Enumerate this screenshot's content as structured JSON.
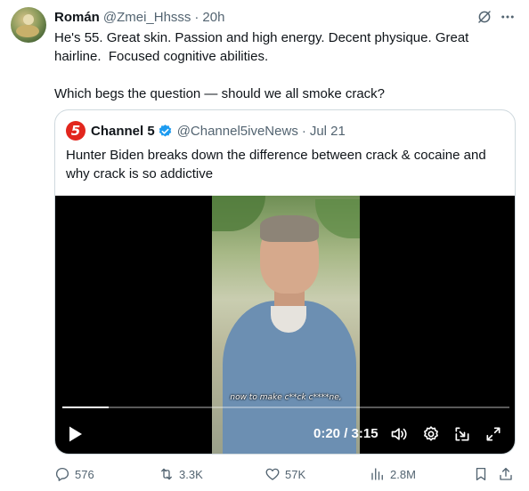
{
  "tweet": {
    "author_name": "Román",
    "author_handle": "@Zmei_Hhsss",
    "separator": "·",
    "time": "20h",
    "text": "He's 55. Great skin. Passion and high energy. Decent physique. Great hairline.  Focused cognitive abilities.\n\nWhich begs the question — should we all smoke crack?"
  },
  "quote": {
    "logo_text": "5",
    "author_name": "Channel 5",
    "author_handle": "@Channel5iveNews",
    "separator": "·",
    "time": "Jul 21",
    "text": "Hunter Biden breaks down the difference between crack & cocaine and why crack is so addictive",
    "video": {
      "subtitle": "now to make c**ck c****ne,",
      "timecode": "0:20 / 3:15",
      "progress_fraction": 0.103
    }
  },
  "actions": {
    "replies": "576",
    "retweets": "3.3K",
    "likes": "57K",
    "views": "2.8M"
  },
  "icons": [
    "grok-icon",
    "more-icon",
    "verified-icon",
    "play-icon",
    "volume-icon",
    "settings-icon",
    "pip-icon",
    "fullscreen-icon",
    "reply-icon",
    "retweet-icon",
    "like-icon",
    "views-icon",
    "bookmark-icon",
    "share-icon"
  ],
  "colors": {
    "text": "#0f1419",
    "muted": "#536471",
    "border": "#cfd9de",
    "verified": "#1d9bf0",
    "channel5_red": "#e2261d"
  }
}
